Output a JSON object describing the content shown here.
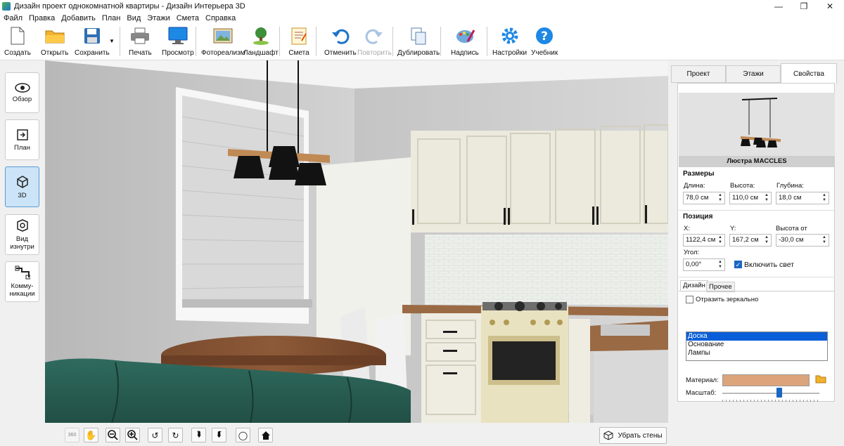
{
  "window": {
    "title": "Дизайн проект однокомнатной квартиры - Дизайн Интерьера 3D"
  },
  "menu": [
    "Файл",
    "Правка",
    "Добавить",
    "План",
    "Вид",
    "Этажи",
    "Смета",
    "Справка"
  ],
  "toolbar": {
    "create": "Создать",
    "open": "Открыть",
    "save": "Сохранить",
    "print": "Печать",
    "preview": "Просмотр",
    "photorealism": "Фотореализм",
    "landscape": "Ландшафт",
    "estimate": "Смета",
    "undo": "Отменить",
    "redo": "Повторить",
    "duplicate": "Дублировать",
    "label": "Надпись",
    "settings": "Настройки",
    "tutorial": "Учебник"
  },
  "leftnav": {
    "overview": "Обзор",
    "plan": "План",
    "view3d": "3D",
    "inside_line1": "Вид",
    "inside_line2": "изнутри",
    "comm_line1": "Комму-",
    "comm_line2": "никации"
  },
  "bottom": {
    "remove_walls": "Убрать стены"
  },
  "tabs": {
    "project": "Проект",
    "floors": "Этажи",
    "properties": "Свойства"
  },
  "props": {
    "preview_caption": "Люстра MACCLES",
    "sizes_header": "Размеры",
    "length_label": "Длина:",
    "length_value": "78,0 см",
    "height_label": "Высота:",
    "height_value": "110,0 см",
    "depth_label": "Глубина:",
    "depth_value": "18,0 см",
    "position_header": "Позиция",
    "x_label": "X:",
    "x_value": "1122,4 см",
    "y_label": "Y:",
    "y_value": "167,2 см",
    "ceil_label": "Высота от потолка:",
    "ceil_value": "-30,0 см",
    "angle_label": "Угол:",
    "angle_value": "0,00°",
    "light_label": "Включить свет",
    "light_checked": true,
    "subtab_design": "Дизайн",
    "subtab_other": "Прочее",
    "mirror_label": "Отразить зеркально",
    "mirror_checked": false,
    "parts": [
      "Доска",
      "Основание",
      "Лампы"
    ],
    "material_label": "Материал:",
    "scale_label": "Масштаб:",
    "material_color": "#dca47a"
  }
}
